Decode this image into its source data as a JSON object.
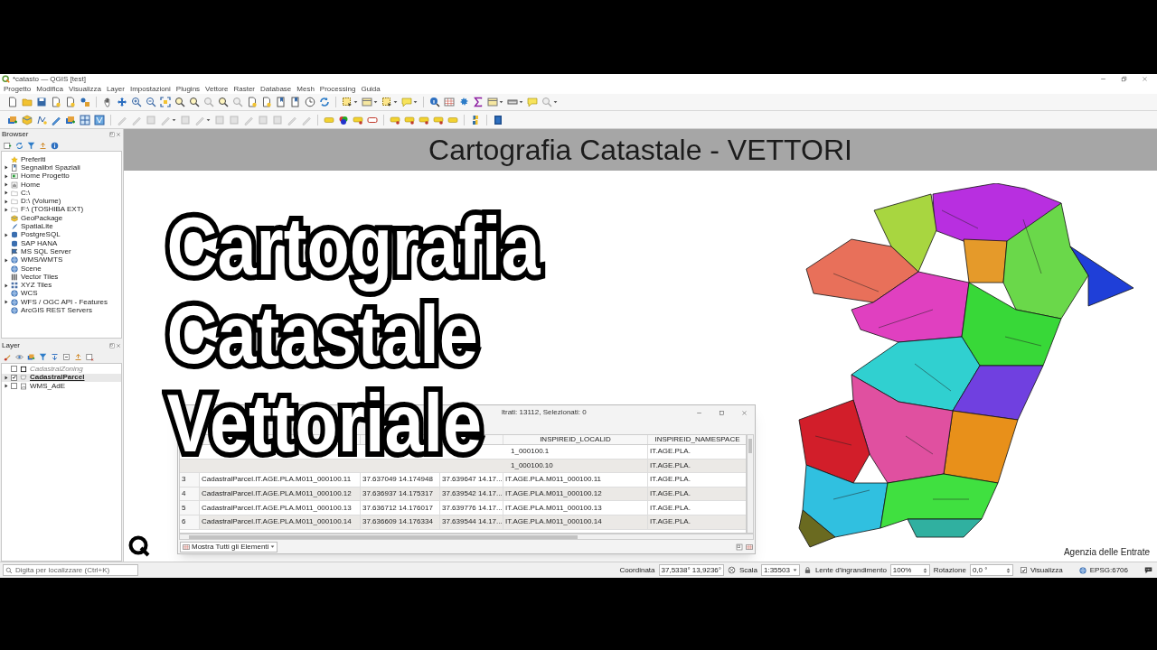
{
  "window": {
    "title": "*catasto — QGIS [test]"
  },
  "menu": [
    "Progetto",
    "Modifica",
    "Visualizza",
    "Layer",
    "Impostazioni",
    "Plugins",
    "Vettore",
    "Raster",
    "Database",
    "Mesh",
    "Processing",
    "Guida"
  ],
  "browser": {
    "title": "Browser",
    "items": [
      {
        "label": "Preferiti",
        "expandable": false
      },
      {
        "label": "Segnalibri Spaziali",
        "expandable": true
      },
      {
        "label": "Home Progetto",
        "expandable": true
      },
      {
        "label": "Home",
        "expandable": true
      },
      {
        "label": "C:\\",
        "expandable": true
      },
      {
        "label": "D:\\ (Volume)",
        "expandable": true
      },
      {
        "label": "F:\\ (TOSHIBA EXT)",
        "expandable": true
      },
      {
        "label": "GeoPackage",
        "expandable": false
      },
      {
        "label": "SpatiaLite",
        "expandable": false
      },
      {
        "label": "PostgreSQL",
        "expandable": true
      },
      {
        "label": "SAP HANA",
        "expandable": false
      },
      {
        "label": "MS SQL Server",
        "expandable": false
      },
      {
        "label": "WMS/WMTS",
        "expandable": true
      },
      {
        "label": "Scene",
        "expandable": false
      },
      {
        "label": "Vector Tiles",
        "expandable": false
      },
      {
        "label": "XYZ Tiles",
        "expandable": true
      },
      {
        "label": "WCS",
        "expandable": false
      },
      {
        "label": "WFS / OGC API - Features",
        "expandable": true
      },
      {
        "label": "ArcGIS REST Servers",
        "expandable": false
      }
    ]
  },
  "layers": {
    "title": "Layer",
    "items": [
      {
        "label": "CadastralZoning",
        "checked": false,
        "expandable": false,
        "current": false,
        "greyed": true
      },
      {
        "label": "CadastralParcel",
        "checked": true,
        "expandable": true,
        "current": true,
        "greyed": false
      },
      {
        "label": "WMS_AdE",
        "checked": false,
        "expandable": true,
        "current": false,
        "greyed": false
      }
    ]
  },
  "map": {
    "banner": "Cartografia Catastale - VETTORI",
    "overlay_title": [
      "Cartografia",
      "Catastale",
      "Vettoriale"
    ],
    "credit": "Agenzia delle Entrate"
  },
  "attribute_table": {
    "title": "ltrati: 13112, Selezionati: 0",
    "columns": [
      "",
      "",
      "",
      "INSPIREID_LOCALID",
      "INSPIREID_NAMESPACE"
    ],
    "covered_rows": [
      {
        "localid": "1_000100.1",
        "namespace": "IT.AGE.PLA."
      },
      {
        "localid": "1_000100.10",
        "namespace": "IT.AGE.PLA."
      }
    ],
    "rows": [
      {
        "number": "3",
        "cells": [
          "CadastralParcel.IT.AGE.PLA.M011_000100.11",
          "37.637049 14.174948",
          "37.639647 14.17...",
          "IT.AGE.PLA.M011_000100.11",
          "IT.AGE.PLA."
        ]
      },
      {
        "number": "4",
        "cells": [
          "CadastralParcel.IT.AGE.PLA.M011_000100.12",
          "37.636937 14.175317",
          "37.639542 14.17...",
          "IT.AGE.PLA.M011_000100.12",
          "IT.AGE.PLA."
        ]
      },
      {
        "number": "5",
        "cells": [
          "CadastralParcel.IT.AGE.PLA.M011_000100.13",
          "37.636712 14.176017",
          "37.639776 14.17...",
          "IT.AGE.PLA.M011_000100.13",
          "IT.AGE.PLA."
        ]
      },
      {
        "number": "6",
        "cells": [
          "CadastralParcel.IT.AGE.PLA.M011_000100.14",
          "37.636609 14.176334",
          "37.639544 14.17...",
          "IT.AGE.PLA.M011_000100.14",
          "IT.AGE.PLA."
        ]
      }
    ],
    "footer_button": "Mostra Tutti gli Elementi"
  },
  "locator": {
    "placeholder": "Digita per localizzare (Ctrl+K)"
  },
  "status_bar": {
    "coordinate_label": "Coordinata",
    "coordinate": "37,5338° 13,9236°",
    "scale_label": "Scala",
    "scale": "1:35503",
    "magnifier_label": "Lente d'ingrandimento",
    "magnifier": "100%",
    "rotation_label": "Rotazione",
    "rotation": "0,0 °",
    "render": {
      "label": "Visualizza",
      "checked": true
    },
    "crs": "EPSG:6706"
  }
}
